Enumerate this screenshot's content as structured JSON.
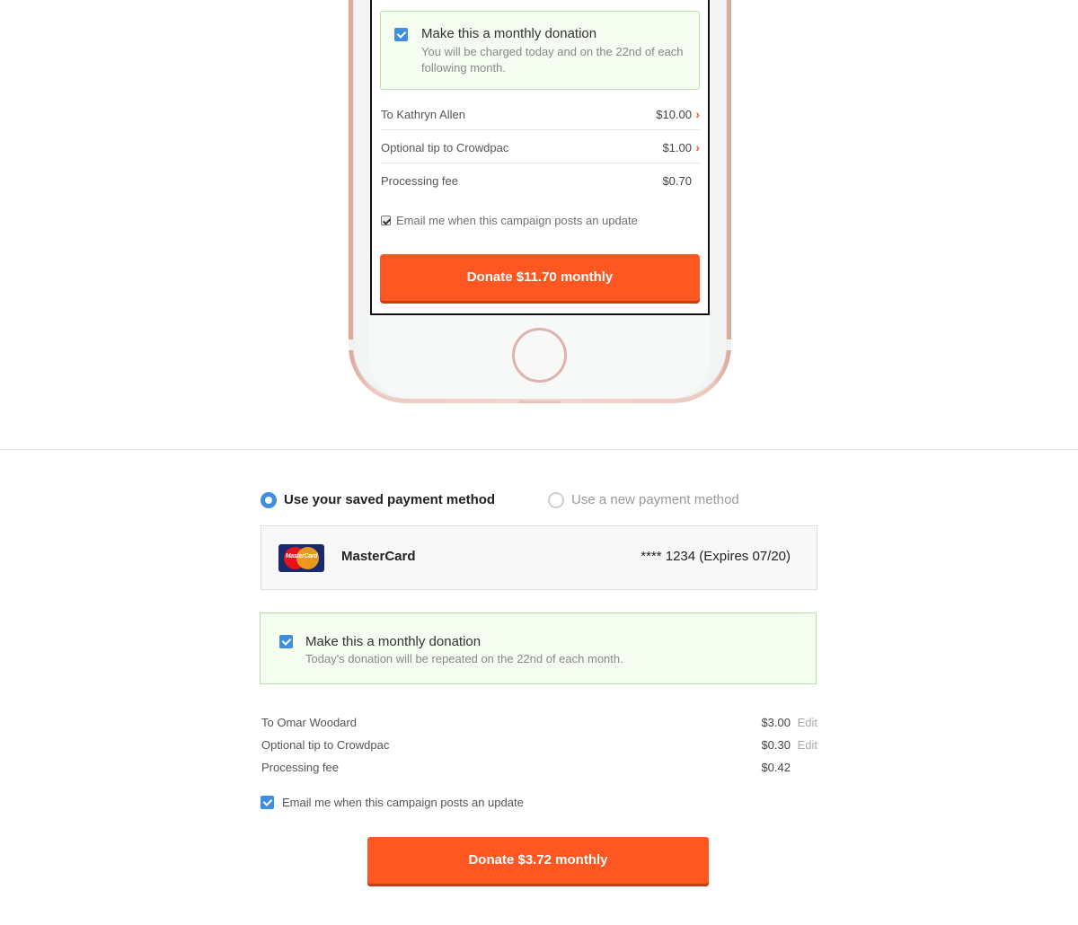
{
  "phone_preview": {
    "monthly_title": "Make this a monthly donation",
    "monthly_sub": "You will be charged today and on the 22nd of each following month.",
    "rows": [
      {
        "label": "To Kathryn Allen",
        "amount": "$10.00",
        "chevron": "›"
      },
      {
        "label": "Optional tip to Crowdpac",
        "amount": "$1.00",
        "chevron": "›"
      },
      {
        "label": "Processing fee",
        "amount": "$0.70"
      }
    ],
    "email_label": "Email me when this campaign posts an update",
    "donate_label": "Donate $11.70 monthly"
  },
  "payment": {
    "saved_label": "Use your saved payment method",
    "new_label": "Use a new payment method",
    "selected": "saved"
  },
  "card": {
    "logo_text": "MasterCard",
    "name": "MasterCard",
    "number": "**** 1234 (Expires 07/20)"
  },
  "monthly": {
    "title": "Make this a monthly donation",
    "sub": "Today's donation will be repeated on the 22nd of each month."
  },
  "breakdown": [
    {
      "label": "To Omar Woodard",
      "amount": "$3.00",
      "edit": "Edit"
    },
    {
      "label": "Optional tip to Crowdpac",
      "amount": "$0.30",
      "edit": "Edit"
    },
    {
      "label": "Processing fee",
      "amount": "$0.42"
    }
  ],
  "email_updates": "Email me when this campaign posts an update",
  "donate_label": "Donate $3.72 monthly",
  "colors": {
    "accent": "#ff5722",
    "check_blue": "#3e8fe0",
    "green_border": "#b8e0a6"
  }
}
